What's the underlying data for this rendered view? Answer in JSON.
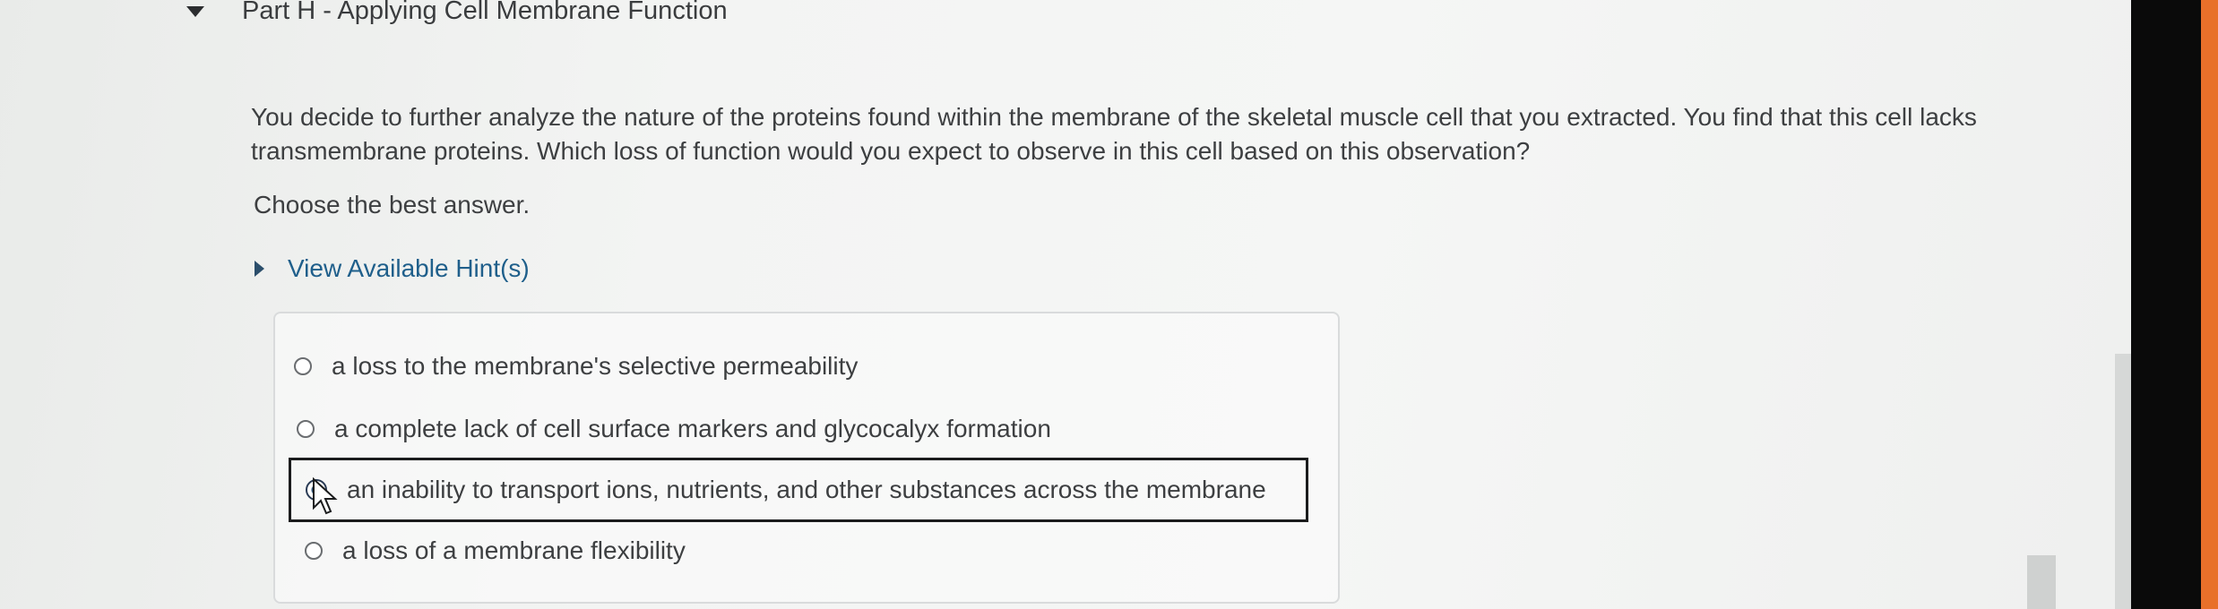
{
  "part": {
    "title": "Part H - Applying Cell Membrane Function",
    "collapse_icon": "caret-down-icon"
  },
  "question": {
    "text": "You decide to further analyze the nature of the proteins found within the membrane of the skeletal muscle cell that you extracted. You find that this cell lacks transmembrane proteins. Which loss of function would you expect to observe in this cell based on this observation?",
    "instruction": "Choose the best answer."
  },
  "hints": {
    "label": "View Available Hint(s)",
    "expand_icon": "caret-right-icon"
  },
  "options": [
    {
      "label": "a loss to the membrane's selective permeability",
      "selected": false
    },
    {
      "label": "a complete lack of cell surface markers and glycocalyx formation",
      "selected": false
    },
    {
      "label": "an inability to transport ions, nutrients, and other substances across the membrane",
      "selected": true
    },
    {
      "label": "a loss of a membrane flexibility",
      "selected": false
    }
  ],
  "colors": {
    "hint_link": "#1f5f8b",
    "selected_outline": "#1b1c1d",
    "text": "#3d3f41"
  }
}
